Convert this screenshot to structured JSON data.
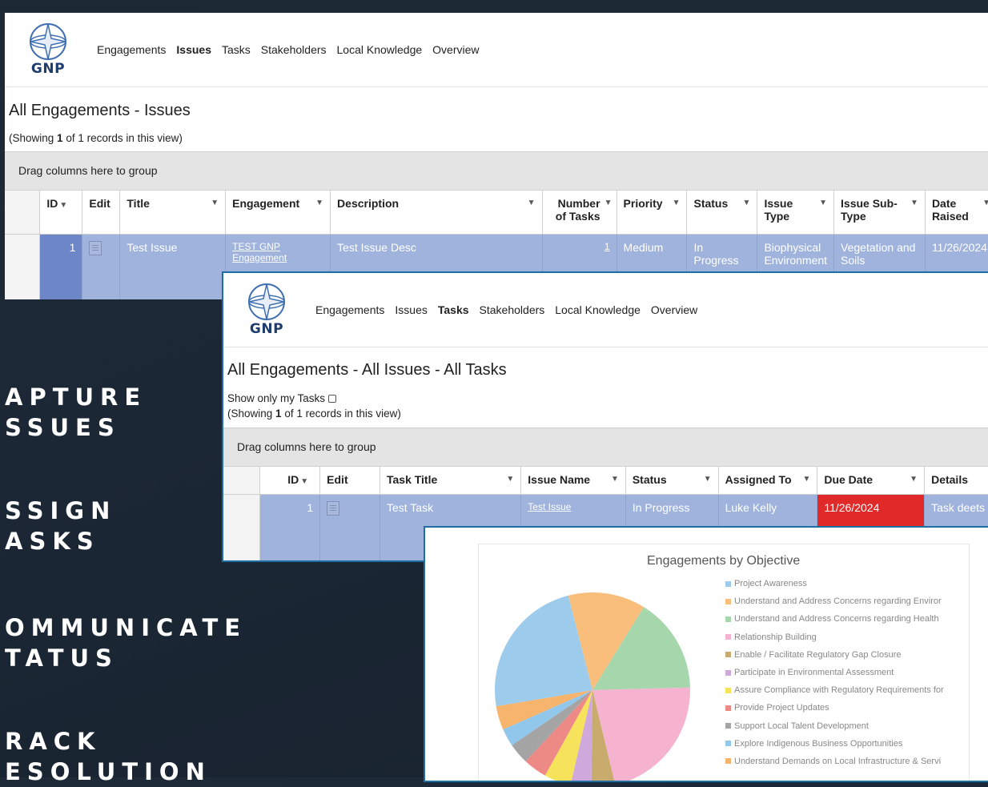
{
  "app": {
    "logo_text": "GNP"
  },
  "marketing": [
    {
      "line1": "APTURE",
      "line2": "SSUES"
    },
    {
      "line1": "SSIGN",
      "line2": "ASKS"
    },
    {
      "line1": "OMMUNICATE",
      "line2": "TATUS"
    },
    {
      "line1": "RACK",
      "line2": "ESOLUTION"
    }
  ],
  "issues_view": {
    "nav": [
      "Engagements",
      "Issues",
      "Tasks",
      "Stakeholders",
      "Local Knowledge",
      "Overview"
    ],
    "active_nav": "Issues",
    "title": "All Engagements - Issues",
    "showing_prefix": "(Showing ",
    "showing_count": "1",
    "showing_suffix": " of 1 records in this view)",
    "group_hint": "Drag columns here to group",
    "columns": {
      "id": "ID",
      "edit": "Edit",
      "title": "Title",
      "engagement": "Engagement",
      "description": "Description",
      "tasks_line1": "Number",
      "tasks_line2": "of Tasks",
      "priority": "Priority",
      "status": "Status",
      "type_line1": "Issue",
      "type_line2": "Type",
      "subtype_line1": "Issue Sub-",
      "subtype_line2": "Type",
      "date_line1": "Date",
      "date_line2": "Raised"
    },
    "row": {
      "id": "1",
      "title": "Test Issue",
      "engagement_line1": "TEST GNP",
      "engagement_line2": "Engagement",
      "description": "Test Issue Desc",
      "tasks": "1",
      "priority": "Medium",
      "status": "In Progress",
      "type_line1": "Biophysical",
      "type_line2": "Environment",
      "subtype_line1": "Vegetation and",
      "subtype_line2": "Soils",
      "date": "11/26/2024"
    }
  },
  "tasks_view": {
    "nav": [
      "Engagements",
      "Issues",
      "Tasks",
      "Stakeholders",
      "Local Knowledge",
      "Overview"
    ],
    "active_nav": "Tasks",
    "title": "All Engagements - All Issues - All Tasks",
    "my_tasks_label": "Show only my Tasks",
    "showing_prefix": "(Showing ",
    "showing_count": "1",
    "showing_suffix": " of 1 records in this view)",
    "group_hint": "Drag columns here to group",
    "columns": {
      "id": "ID",
      "edit": "Edit",
      "task_title": "Task Title",
      "issue_name": "Issue Name",
      "status": "Status",
      "assigned_to": "Assigned To",
      "due_date": "Due Date",
      "details": "Details"
    },
    "row": {
      "id": "1",
      "task_title": "Test Task",
      "issue_name": "Test Issue",
      "status": "In Progress",
      "assigned_to": "Luke Kelly",
      "due_date": "11/26/2024",
      "details": "Task deets"
    }
  },
  "chart_data": {
    "type": "pie",
    "title": "Engagements by Objective",
    "categories": [
      "Project Awareness",
      "Understand and Address Concerns regarding Enviror",
      "Understand and Address Concerns regarding Health",
      "Relationship Building",
      "Enable / Facilitate Regulatory Gap Closure",
      "Participate in Environmental Assessment",
      "Assure Compliance with Regulatory Requirements for",
      "Provide Project Updates",
      "Support Local Talent Development",
      "Explore Indigenous Business Opportunities",
      "Understand Demands on Local Infrastructure & Servi"
    ],
    "values": [
      24,
      13,
      16,
      22,
      4,
      3.5,
      4.5,
      4,
      3.5,
      3,
      4
    ],
    "colors": [
      "#9ccbec",
      "#f9be7c",
      "#a6d6ab",
      "#f5b3cf",
      "#c9ab6e",
      "#cfa8dc",
      "#f6e35b",
      "#ee8a86",
      "#a4a4a4",
      "#92c7ec",
      "#f7b46c"
    ],
    "legend_position": "right"
  }
}
